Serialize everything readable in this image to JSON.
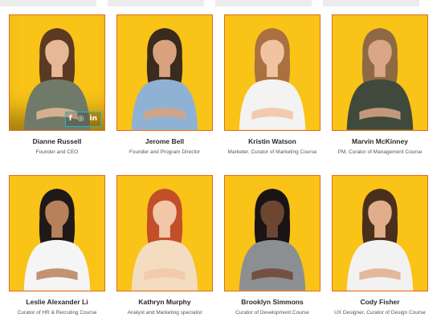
{
  "team": [
    {
      "name": "Dianne Russell",
      "role": "Founder and CEO",
      "shirt": "#6f7a69",
      "hair": "#5a3a22",
      "skin": "#e8b896",
      "social": [
        "f",
        "◎",
        "in"
      ]
    },
    {
      "name": "Jerome Bell",
      "role": "Founder and Program Director",
      "shirt": "#8fb2d4",
      "hair": "#3b2a1e",
      "skin": "#d9a27f"
    },
    {
      "name": "Kristin Watson",
      "role": "Marketer, Curator of Marketing Course",
      "shirt": "#f3f3f1",
      "hair": "#a9713f",
      "skin": "#f0c3a3"
    },
    {
      "name": "Marvin McKinney",
      "role": "PM, Curator of Management Course",
      "shirt": "#3f4a3c",
      "hair": "#8d6a43",
      "skin": "#dba685"
    },
    {
      "name": "Leslie Alexander Li",
      "role": "Curator of HR & Recruting Course",
      "shirt": "#f5f5f5",
      "hair": "#1f1a17",
      "skin": "#b7815b"
    },
    {
      "name": "Kathryn Murphy",
      "role": "Analyst and Marketing specialist",
      "shirt": "#f3dcc0",
      "hair": "#c24e2a",
      "skin": "#f1c7a8"
    },
    {
      "name": "Brooklyn Simmons",
      "role": "Curator of Development Course",
      "shirt": "#8c8f92",
      "hair": "#1a1414",
      "skin": "#6d4632"
    },
    {
      "name": "Cody Fisher",
      "role": "UX Designer, Curator of Design Course",
      "shirt": "#f2f2f2",
      "hair": "#4a2f1d",
      "skin": "#e1ae8b"
    }
  ]
}
